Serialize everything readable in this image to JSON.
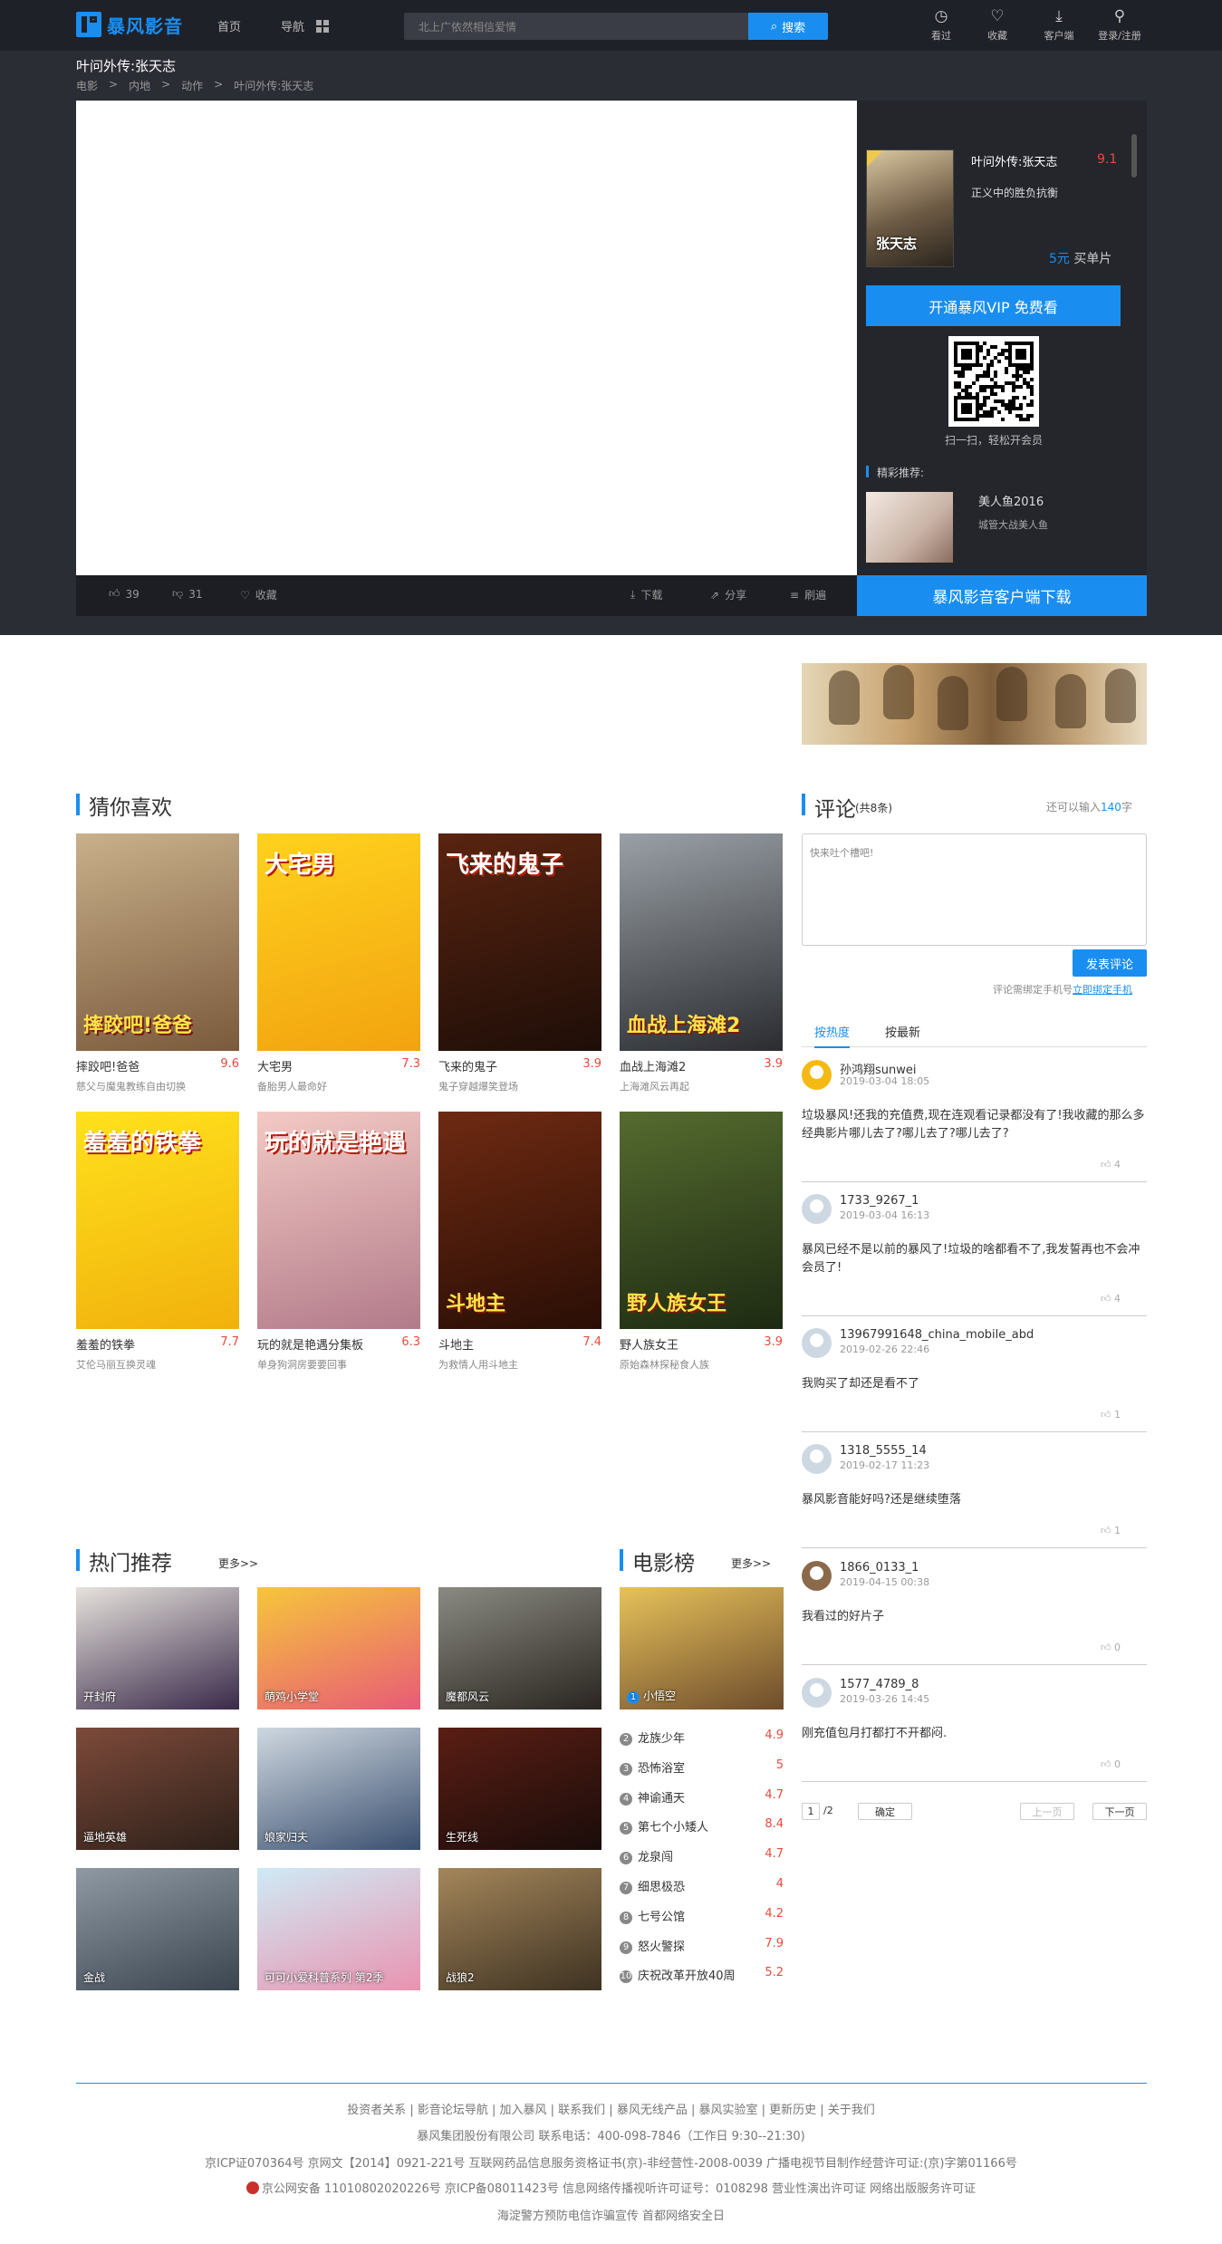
{
  "header": {
    "brand": "暴风影音",
    "nav": [
      "首页",
      "导航"
    ],
    "search_placeholder": "北上广依然相信爱情",
    "search_button": "搜索",
    "icons": [
      {
        "icon": "clock-icon",
        "label": "看过"
      },
      {
        "icon": "heart-icon",
        "label": "收藏"
      },
      {
        "icon": "download-icon",
        "label": "客户端"
      },
      {
        "icon": "user-icon",
        "label": "登录/注册"
      }
    ]
  },
  "page": {
    "title": "叶问外传:张天志",
    "breadcrumb": [
      "电影",
      ">",
      "内地",
      ">",
      "动作",
      ">",
      "叶问外传:张天志"
    ]
  },
  "player_side": {
    "poster_text": "张天志",
    "title": "叶问外传:张天志",
    "score": "9.1",
    "subtitle": "正义中的胜负抗衡",
    "price": "5元",
    "price_suffix": "买单片",
    "vip_button": "开通暴风VIP 免费看",
    "qr_caption": "扫一扫，轻松开会员",
    "rec_label": "精彩推荐:",
    "rec_title": "美人鱼2016",
    "rec_sub": "城管大战美人鱼"
  },
  "player_bar": {
    "likes": "39",
    "dislikes": "31",
    "fav": "收藏",
    "download": "下载",
    "share": "分享",
    "danmaku": "刷遍",
    "client_button": "暴风影音客户端下载"
  },
  "guess": {
    "title": "猜你喜欢",
    "items": [
      {
        "name": "摔跤吧!爸爸",
        "score": "9.6",
        "desc": "慈父与魔鬼教练自由切换",
        "poster_top": "",
        "poster_bottom": "摔跤吧!爸爸",
        "colors": [
          "#c9b08a",
          "#7a5a3c"
        ]
      },
      {
        "name": "大宅男",
        "score": "7.3",
        "desc": "备胎男人最命好",
        "poster_top": "大宅男",
        "poster_bottom": "",
        "colors": [
          "#ffd21e",
          "#f2a30f"
        ]
      },
      {
        "name": "飞来的鬼子",
        "score": "3.9",
        "desc": "鬼子穿越爆笑登场",
        "poster_top": "飞来的鬼子",
        "poster_bottom": "",
        "colors": [
          "#5a2410",
          "#1e0e08"
        ]
      },
      {
        "name": "血战上海滩2",
        "score": "3.9",
        "desc": "上海滩风云再起",
        "poster_top": "",
        "poster_bottom": "血战上海滩2",
        "colors": [
          "#9aa0a6",
          "#2a2c30"
        ]
      },
      {
        "name": "羞羞的铁拳",
        "score": "7.7",
        "desc": "艾伦马丽互换灵魂",
        "poster_top": "羞羞的铁拳",
        "poster_bottom": "",
        "colors": [
          "#ffe11c",
          "#f1b10c"
        ]
      },
      {
        "name": "玩的就是艳遇分集板",
        "score": "6.3",
        "desc": "单身狗洞房要要回事",
        "poster_top": "玩的就是艳遇",
        "poster_bottom": "",
        "colors": [
          "#f3c9c4",
          "#b27b8a"
        ]
      },
      {
        "name": "斗地主",
        "score": "7.4",
        "desc": "为救情人用斗地主",
        "poster_top": "",
        "poster_bottom": "斗地主",
        "colors": [
          "#6e2a12",
          "#2a0e05"
        ]
      },
      {
        "name": "野人族女王",
        "score": "3.9",
        "desc": "原始森林探秘食人族",
        "poster_top": "",
        "poster_bottom": "野人族女王",
        "colors": [
          "#556b2f",
          "#1d2a12"
        ]
      }
    ]
  },
  "hot": {
    "title": "热门推荐",
    "more": "更多>>",
    "items": [
      {
        "caption": "开封府",
        "colors": [
          "#e6e2dc",
          "#3a2a4a"
        ]
      },
      {
        "caption": "萌鸡小学堂",
        "colors": [
          "#f6c63b",
          "#e85b77"
        ]
      },
      {
        "caption": "魔都风云",
        "colors": [
          "#8a8a82",
          "#2a2520"
        ]
      },
      {
        "caption": "逼地英雄",
        "colors": [
          "#7d4a3a",
          "#2d2019"
        ]
      },
      {
        "caption": "娘家归夫",
        "colors": [
          "#cfd8e0",
          "#3a4f6f"
        ]
      },
      {
        "caption": "生死线",
        "colors": [
          "#5a1e14",
          "#1a0c0a"
        ]
      },
      {
        "caption": "金战",
        "colors": [
          "#8e99a4",
          "#3b454f"
        ]
      },
      {
        "caption": "可可小爱科普系列 第2季",
        "colors": [
          "#cfeaf5",
          "#e993b0"
        ]
      },
      {
        "caption": "战狼2",
        "colors": [
          "#a4865a",
          "#3e3222"
        ]
      }
    ]
  },
  "chart_rank": {
    "title": "电影榜",
    "more": "更多>>",
    "top": {
      "rank": "1",
      "name": "小悟空",
      "colors": [
        "#e7c25a",
        "#6e4c2c"
      ]
    },
    "items": [
      {
        "rank": "2",
        "name": "龙族少年",
        "score": "4.9"
      },
      {
        "rank": "3",
        "name": "恐怖浴室",
        "score": "5"
      },
      {
        "rank": "4",
        "name": "神谕通天",
        "score": "4.7"
      },
      {
        "rank": "5",
        "name": "第七个小矮人",
        "score": "8.4"
      },
      {
        "rank": "6",
        "name": "龙泉闯",
        "score": "4.7"
      },
      {
        "rank": "7",
        "name": "细思极恐",
        "score": "4"
      },
      {
        "rank": "8",
        "name": "七号公馆",
        "score": "4.2"
      },
      {
        "rank": "9",
        "name": "怒火警探",
        "score": "7.9"
      },
      {
        "rank": "10",
        "name": "庆祝改革开放40周",
        "score": "5.2"
      }
    ]
  },
  "comments": {
    "title": "评论",
    "count": "(共8条)",
    "limit_prefix": "还可以输入",
    "limit_num": "140",
    "limit_suffix": "字",
    "placeholder": "快来吐个槽吧!",
    "post_button": "发表评论",
    "bind_prefix": "评论需绑定手机号",
    "bind_link": "立即绑定手机",
    "tabs": [
      "按热度",
      "按最新"
    ],
    "list": [
      {
        "user": "孙鸿翔sunwei",
        "date": "2019-03-04 18:05",
        "text": "垃圾暴风!还我的充值费,现在连观看记录都没有了!我收藏的那么多经典影片哪儿去了?哪儿去了?哪儿去了?",
        "likes": "4",
        "avatar": "#f5b914"
      },
      {
        "user": "1733_9267_1",
        "date": "2019-03-04 16:13",
        "text": "暴风已经不是以前的暴风了!垃圾的啥都看不了,我发誓再也不会冲会员了!",
        "likes": "4",
        "avatar": "#cdd8e2"
      },
      {
        "user": "13967991648_china_mobile_abd",
        "date": "2019-02-26 22:46",
        "text": "我购买了却还是看不了",
        "likes": "1",
        "avatar": "#cdd8e2"
      },
      {
        "user": "1318_5555_14",
        "date": "2019-02-17 11:23",
        "text": "暴风影音能好吗?还是继续堕落",
        "likes": "1",
        "avatar": "#cdd8e2"
      },
      {
        "user": "1866_0133_1",
        "date": "2019-04-15 00:38",
        "text": "我看过的好片子",
        "likes": "0",
        "avatar": "#8a6a4a"
      },
      {
        "user": "1577_4789_8",
        "date": "2019-03-26 14:45",
        "text": "刚充值包月打都打不开都闷.",
        "likes": "0",
        "avatar": "#cdd8e2"
      }
    ],
    "pager": {
      "page": "1",
      "total": "/2",
      "confirm": "确定",
      "prev": "上一页",
      "next": "下一页"
    }
  },
  "footer": {
    "links": "投资者关系 | 影音论坛导航 | 加入暴风 | 联系我们 | 暴风无线产品 | 暴风实验室 | 更新历史 | 关于我们",
    "company": "暴风集团股份有限公司 联系电话：400-098-7846（工作日 9:30--21:30)",
    "license1": "京ICP证070364号    京网文【2014】0921-221号    互联网药品信息服务资格证书(京)-非经营性-2008-0039    广播电视节目制作经营许可证:(京)字第01166号",
    "license2": "京公网安备 11010802020226号    京ICP备08011423号    信息网络传播视听许可证号：0108298    营业性演出许可证    网络出版服务许可证",
    "license3": "海淀警方预防电信诈骗宣传    首都网络安全日"
  },
  "colors": {
    "accent": "#1a8ef0",
    "score": "#e84b3c",
    "header_bg": "#1f2128",
    "band_bg": "#2b2d34"
  }
}
